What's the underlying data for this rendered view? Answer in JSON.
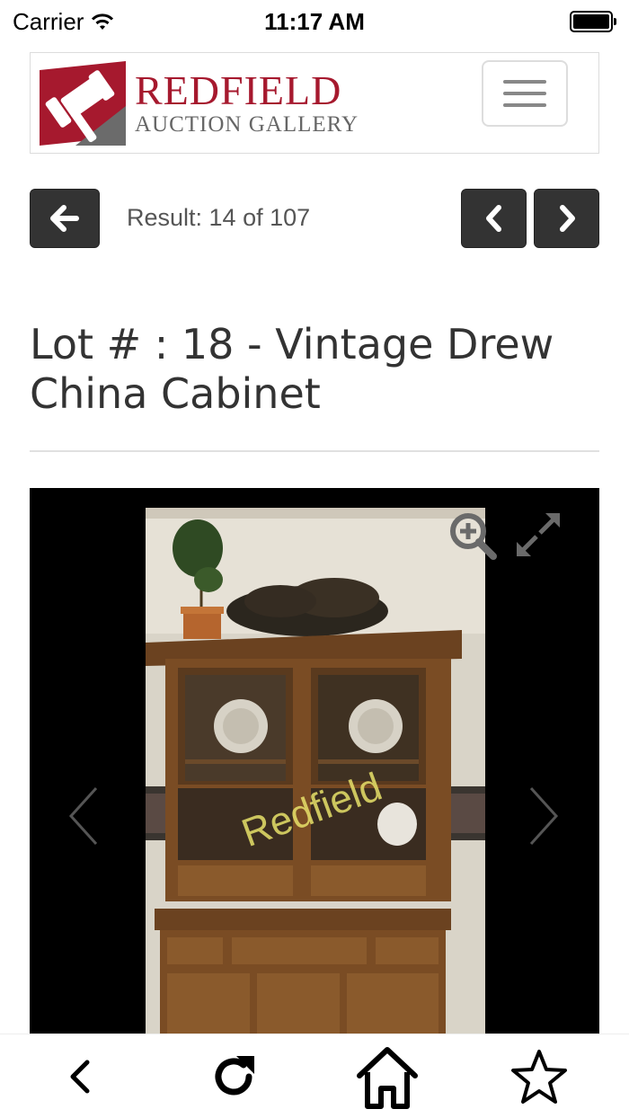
{
  "status_bar": {
    "carrier": "Carrier",
    "time": "11:17 AM"
  },
  "header": {
    "logo_name": "REDFIELD",
    "logo_subtitle": "AUCTION GALLERY",
    "logo_colors": {
      "red": "#a6192e",
      "gray": "#666666"
    },
    "menu_icon": "hamburger-icon"
  },
  "result_nav": {
    "back_icon": "arrow-left-icon",
    "result_text": "Result: 14 of 107",
    "prev_icon": "chevron-left-icon",
    "next_icon": "chevron-right-icon"
  },
  "lot": {
    "title": "Lot # : 18 - Vintage Drew China Cabinet"
  },
  "gallery": {
    "watermark": "Redfield",
    "zoom_icon": "zoom-in-icon",
    "fullscreen_icon": "expand-icon",
    "prev_icon": "chevron-left-icon",
    "next_icon": "chevron-right-icon"
  },
  "toolbar": {
    "back_icon": "chevron-left-icon",
    "reload_icon": "reload-icon",
    "home_icon": "home-icon",
    "favorite_icon": "star-icon"
  }
}
